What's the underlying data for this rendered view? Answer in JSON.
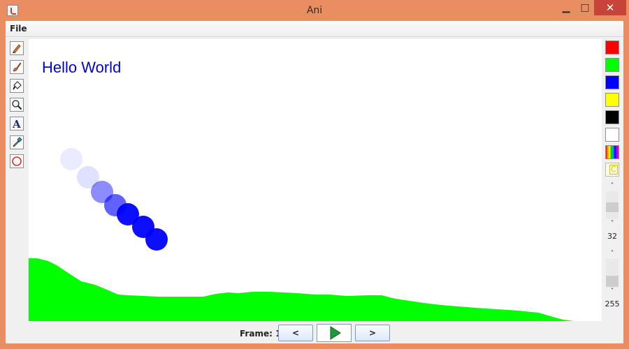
{
  "window": {
    "title": "Ani",
    "min": "▁",
    "max": "□",
    "close": "✕"
  },
  "menu": {
    "file": "File"
  },
  "tools": [
    {
      "name": "pencil-tool",
      "icon": "pencil-icon"
    },
    {
      "name": "brush-tool",
      "icon": "brush-icon"
    },
    {
      "name": "fill-tool",
      "icon": "paint-bucket-icon"
    },
    {
      "name": "zoom-tool",
      "icon": "magnifier-icon"
    },
    {
      "name": "text-tool",
      "icon": "text-icon",
      "glyph": "A"
    },
    {
      "name": "eyedropper-tool",
      "icon": "eyedropper-icon"
    },
    {
      "name": "eraser-tool",
      "icon": "eraser-icon"
    }
  ],
  "canvas": {
    "text": "Hello World",
    "text_color": "#0000e6",
    "ground_color": "#00ff00",
    "ball_color": "#0000ff",
    "ball_opacities": [
      0.08,
      0.12,
      0.45,
      0.62,
      0.95,
      0.95,
      0.95
    ]
  },
  "palette": [
    {
      "name": "red",
      "color": "#ff0000"
    },
    {
      "name": "green",
      "color": "#00ff00"
    },
    {
      "name": "blue",
      "color": "#0000ff"
    },
    {
      "name": "yellow",
      "color": "#ffff00"
    },
    {
      "name": "black",
      "color": "#000000"
    },
    {
      "name": "white",
      "color": "#ffffff"
    }
  ],
  "custom_color_label": "C",
  "size_slider": {
    "value": "32"
  },
  "alpha_slider": {
    "value": "255"
  },
  "frame": {
    "label": "Frame: 1",
    "prev": "<",
    "next": ">"
  }
}
